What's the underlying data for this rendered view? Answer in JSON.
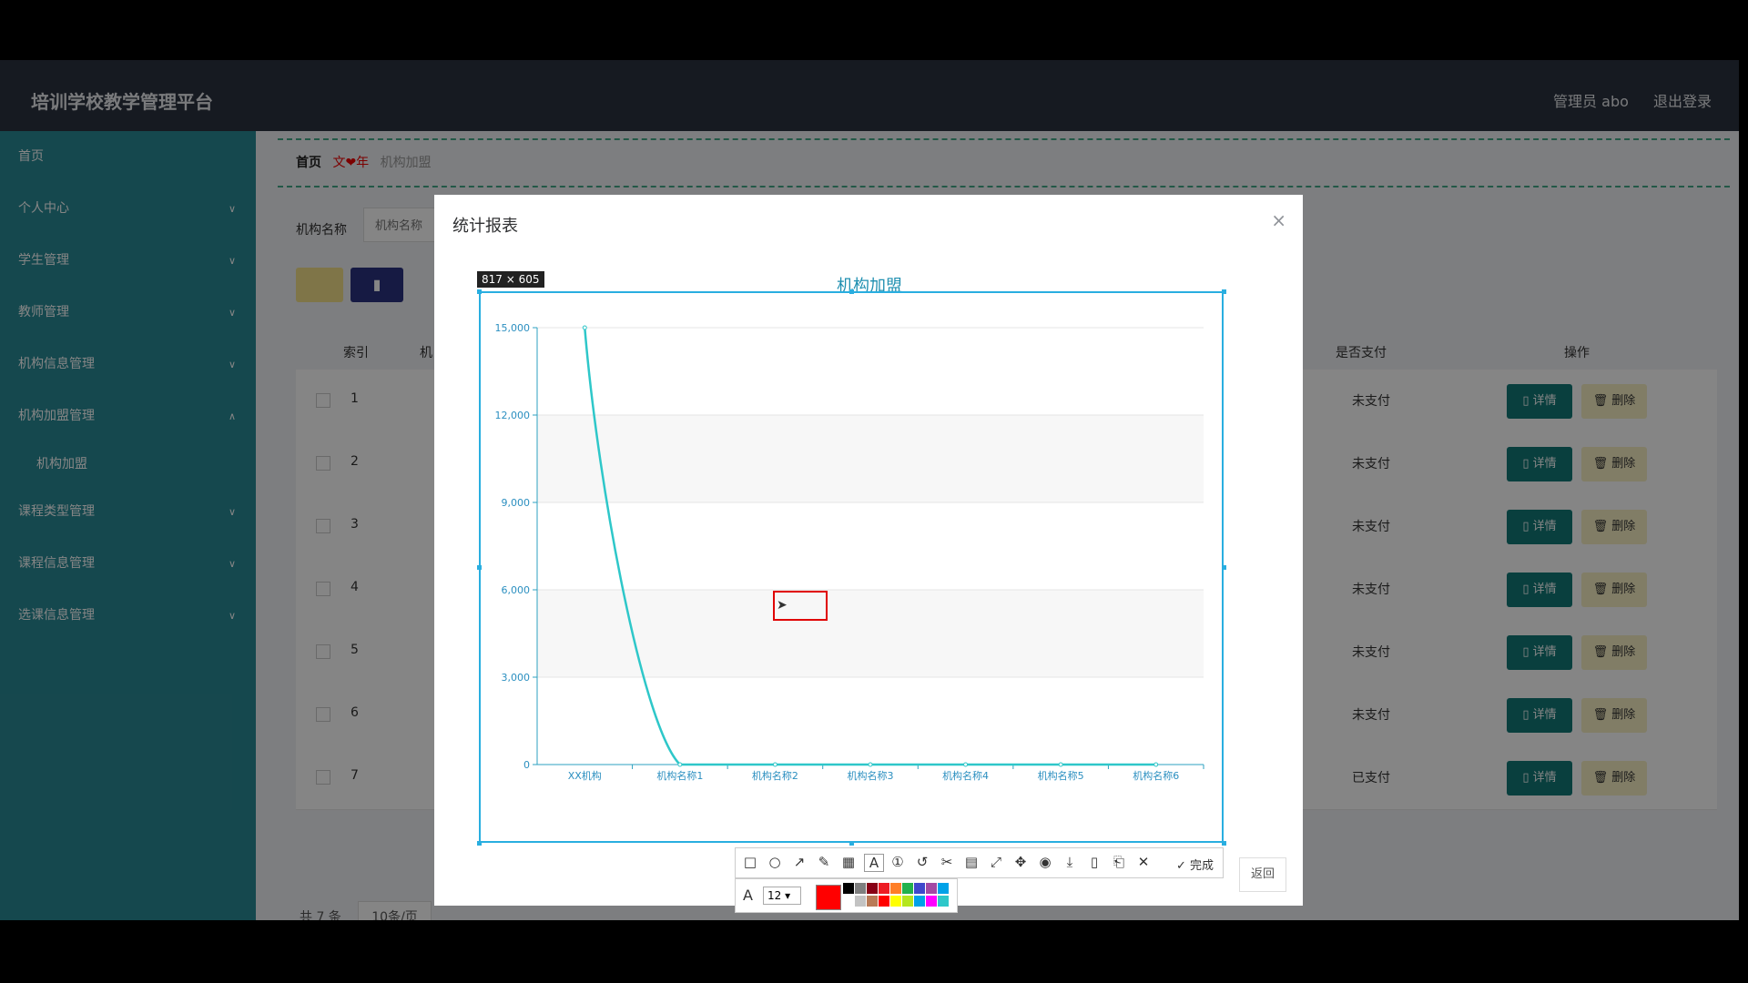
{
  "app": {
    "title": "培训学校教学管理平台",
    "user": "管理员 abo",
    "logout": "退出登录"
  },
  "sidebar": {
    "items": [
      {
        "label": "首页",
        "chev": ""
      },
      {
        "label": "个人中心",
        "chev": "v"
      },
      {
        "label": "学生管理",
        "chev": "v"
      },
      {
        "label": "教师管理",
        "chev": "v"
      },
      {
        "label": "机构信息管理",
        "chev": "v"
      },
      {
        "label": "机构加盟管理",
        "chev": "^"
      }
    ],
    "sub": "机构加盟",
    "items2": [
      {
        "label": "课程类型管理",
        "chev": "v"
      },
      {
        "label": "课程信息管理",
        "chev": "v"
      },
      {
        "label": "选课信息管理",
        "chev": "v"
      }
    ]
  },
  "breadcrumb": {
    "home": "首页",
    "sep": "文❤年",
    "current": "机构加盟"
  },
  "search": {
    "label": "机构名称",
    "placeholder": "机构名称"
  },
  "table": {
    "col_index": "索引",
    "col_org": "机",
    "col_paid": "是否支付",
    "col_action": "操作",
    "detail_label": "详情",
    "delete_label": "删除",
    "rows": [
      {
        "idx": "1",
        "paid": "未支付"
      },
      {
        "idx": "2",
        "paid": "未支付"
      },
      {
        "idx": "3",
        "paid": "未支付"
      },
      {
        "idx": "4",
        "paid": "未支付"
      },
      {
        "idx": "5",
        "paid": "未支付"
      },
      {
        "idx": "6",
        "paid": "未支付"
      },
      {
        "idx": "7",
        "paid": "已支付"
      }
    ]
  },
  "pager": {
    "total": "共 7 条",
    "size": "10条/页"
  },
  "dialog": {
    "title": "统计报表",
    "close": "×",
    "back": "返回"
  },
  "capture": {
    "size_label": "817 × 605",
    "done": "完成",
    "font_size": "12"
  },
  "chart_data": {
    "type": "line",
    "title": "机构加盟",
    "categories": [
      "XX机构",
      "机构名称1",
      "机构名称2",
      "机构名称3",
      "机构名称4",
      "机构名称5",
      "机构名称6"
    ],
    "values": [
      15000,
      0,
      0,
      0,
      0,
      0,
      0
    ],
    "ylim": [
      0,
      15000
    ],
    "yticks": [
      "0",
      "3,000",
      "6,000",
      "9,000",
      "12,000",
      "15,000"
    ],
    "line_color": "#2ec7c9"
  },
  "colors": {
    "header": "#2b3340",
    "sidebar": "#2a8b96",
    "detail_btn": "#137a78",
    "selection": "#29aee0",
    "annot_red": "#e00000"
  }
}
